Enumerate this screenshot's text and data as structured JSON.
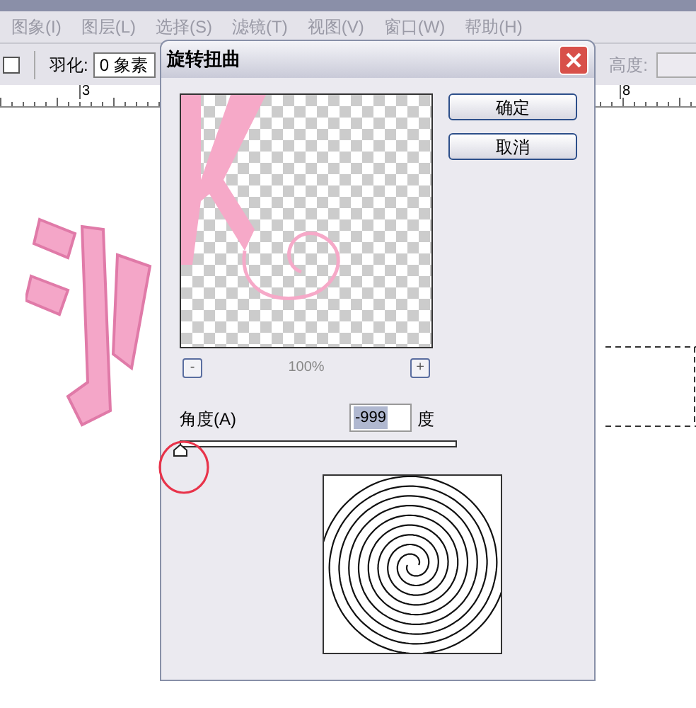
{
  "menu": [
    "图象(I)",
    "图层(L)",
    "选择(S)",
    "滤镜(T)",
    "视图(V)",
    "窗口(W)",
    "帮助(H)"
  ],
  "options_bar": {
    "feather_label": "羽化:",
    "feather_value": "0 象素",
    "height_label": "高度:"
  },
  "ruler": {
    "ticks": [
      "3",
      "8"
    ]
  },
  "dialog": {
    "title": "旋转扭曲",
    "buttons": [
      "确定",
      "取消"
    ],
    "zoom": {
      "minus": "-",
      "value": "100%",
      "plus": "+"
    },
    "angle": {
      "label": "角度(A)",
      "value": "-999",
      "value_selected": true,
      "unit": "度",
      "level": 0
    }
  }
}
